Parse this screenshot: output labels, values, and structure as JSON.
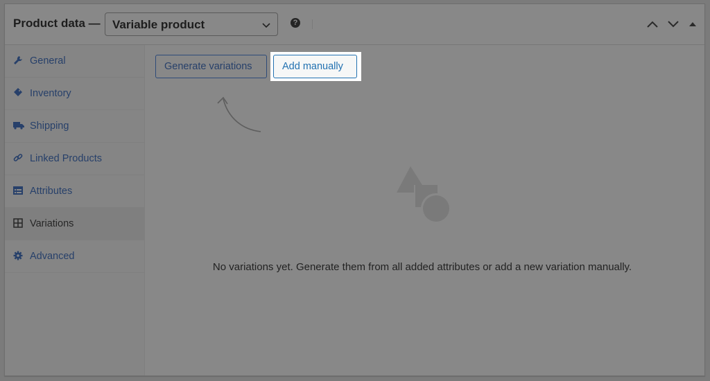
{
  "header": {
    "title": "Product data —",
    "product_type_selected": "Variable product",
    "help_icon": "question-circle-icon",
    "controls": [
      "move-up-icon",
      "move-down-icon",
      "toggle-collapse-icon"
    ]
  },
  "sidebar": {
    "items": [
      {
        "label": "General",
        "icon": "wrench-icon",
        "active": false
      },
      {
        "label": "Inventory",
        "icon": "tag-icon",
        "active": false
      },
      {
        "label": "Shipping",
        "icon": "truck-icon",
        "active": false
      },
      {
        "label": "Linked Products",
        "icon": "link-icon",
        "active": false
      },
      {
        "label": "Attributes",
        "icon": "list-card-icon",
        "active": false
      },
      {
        "label": "Variations",
        "icon": "grid-icon",
        "active": true
      },
      {
        "label": "Advanced",
        "icon": "gear-icon",
        "active": false
      }
    ]
  },
  "main": {
    "generate_label": "Generate variations",
    "add_manually_label": "Add manually",
    "empty_state": {
      "illustration": "shapes-icon",
      "message": "No variations yet. Generate them from all added attributes or add a new variation manually."
    }
  },
  "colors": {
    "link": "#2271b1",
    "overlay_link": "#27406a",
    "highlight": "#ffffff"
  }
}
